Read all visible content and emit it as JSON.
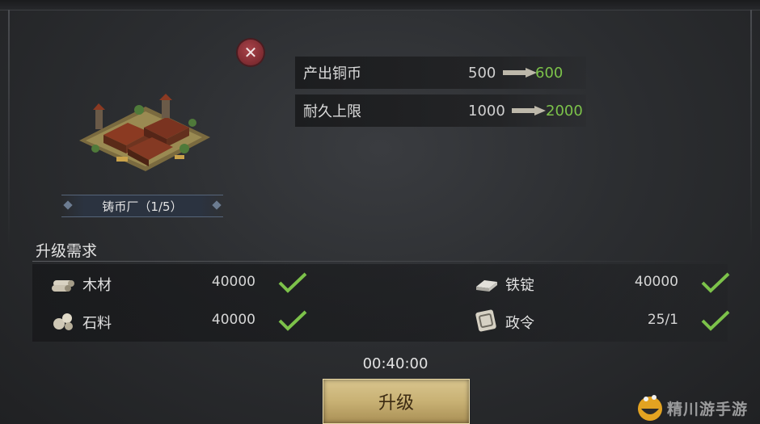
{
  "building": {
    "name": "铸币厂（1/5）"
  },
  "stats": [
    {
      "label": "产出铜币",
      "from": "500",
      "to": "600"
    },
    {
      "label": "耐久上限",
      "from": "1000",
      "to": "2000"
    }
  ],
  "requirements": {
    "title": "升级需求",
    "items": [
      {
        "name": "木材",
        "value": "40000",
        "met": true,
        "icon": "wood-icon"
      },
      {
        "name": "铁锭",
        "value": "40000",
        "met": true,
        "icon": "iron-ingot-icon"
      },
      {
        "name": "石料",
        "value": "40000",
        "met": true,
        "icon": "stone-icon"
      },
      {
        "name": "政令",
        "value": "25/1",
        "met": true,
        "icon": "decree-icon"
      }
    ]
  },
  "timer": "00:40:00",
  "upgrade_button": "升级",
  "watermark": {
    "text": "精川游手游"
  },
  "colors": {
    "increase": "#7cc24a",
    "check": "#7cc24a",
    "close": "#8c2f36",
    "button_gold": "#c8b174"
  }
}
